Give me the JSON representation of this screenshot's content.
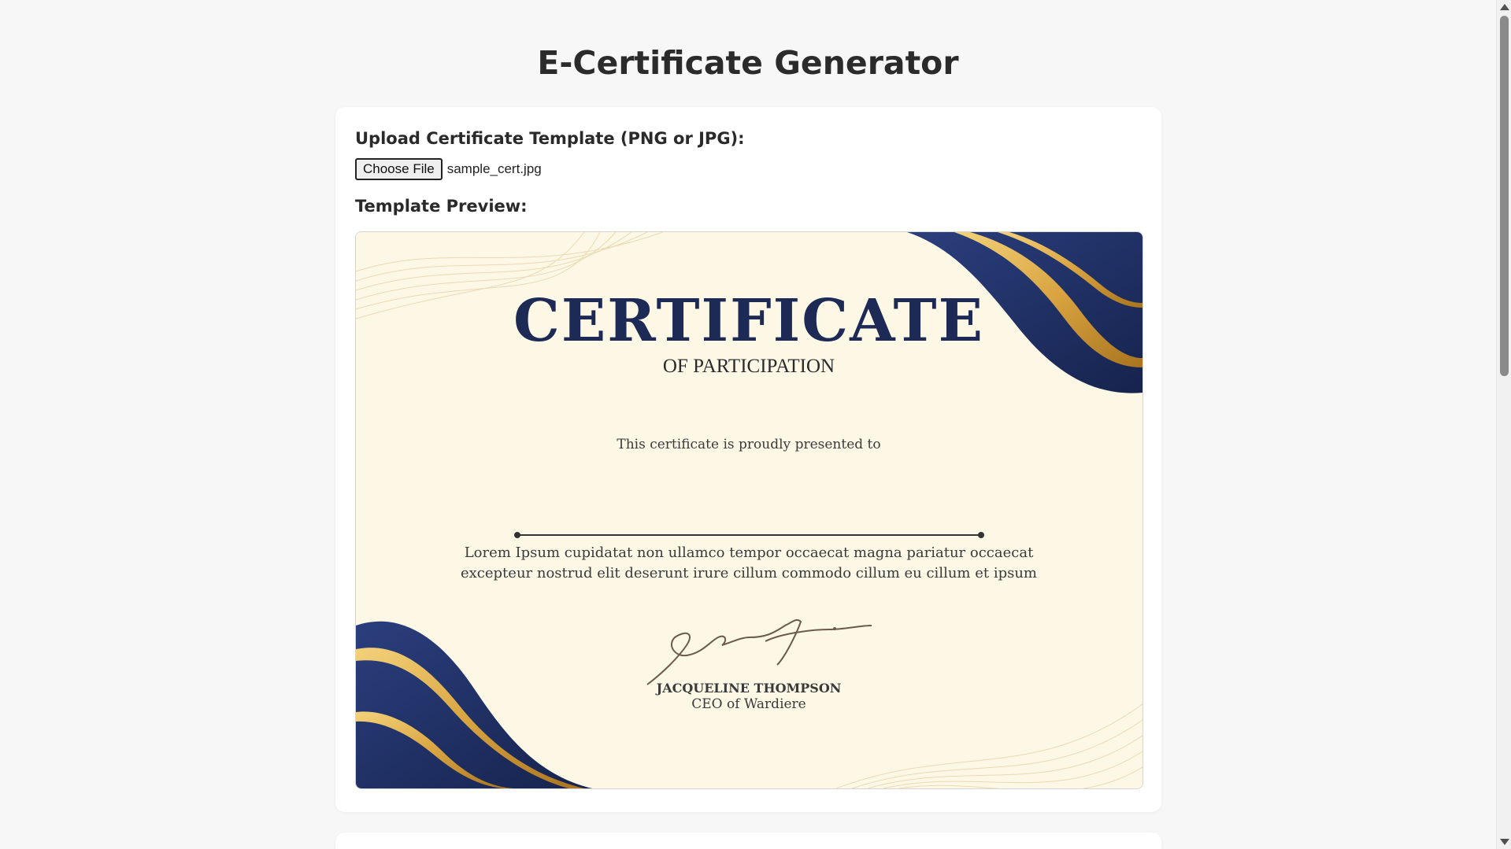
{
  "page": {
    "title": "E-Certificate Generator"
  },
  "upload": {
    "label": "Upload Certificate Template (PNG or JPG):",
    "button_label": "Choose File",
    "file_name": "sample_cert.jpg"
  },
  "preview": {
    "label": "Template Preview:",
    "certificate": {
      "title": "CERTIFICATE",
      "subtitle": "OF PARTICIPATION",
      "presented_to": "This certificate is proudly presented to",
      "body_line_1": "Lorem Ipsum cupidatat non ullamco tempor occaecat magna pariatur occaecat",
      "body_line_2": "excepteur nostrud elit deserunt irure cillum commodo cillum eu cillum et ipsum",
      "signature_text": "Signature",
      "signer_name": "JACQUELINE THOMPSON",
      "signer_title": "CEO of Wardiere",
      "colors": {
        "navy": "#1c2a55",
        "gold": "#d9a441",
        "background": "#fdf7e6"
      }
    }
  }
}
